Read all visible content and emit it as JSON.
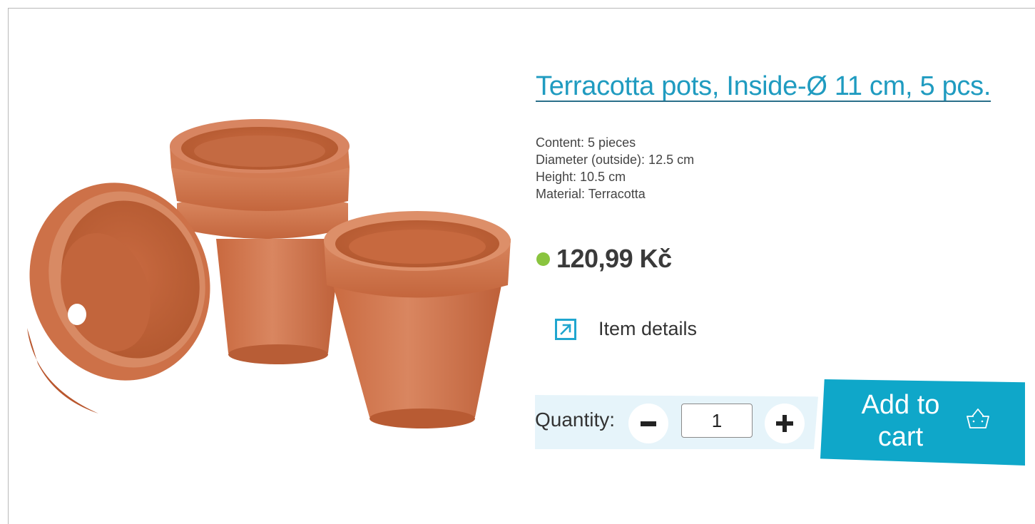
{
  "product": {
    "title": "Terracotta pots, Inside-Ø 11 cm, 5 pcs.",
    "specs": [
      "Content: 5 pieces",
      "Diameter (outside): 12.5 cm",
      "Height: 10.5 cm",
      "Material: Terracotta"
    ],
    "price": "120,99 Kč",
    "availability_color": "#8ac43f"
  },
  "details_link": {
    "label": "Item details",
    "icon": "external-link-arrow-icon"
  },
  "quantity": {
    "label": "Quantity:",
    "value": "1",
    "minus_icon": "minus-icon",
    "plus_icon": "plus-icon"
  },
  "cart": {
    "label": "Add to\ncart",
    "icon": "shopping-basket-icon"
  },
  "colors": {
    "accent": "#0fa7c9",
    "title": "#1f9bc0",
    "terracotta": "#d5794f",
    "quantity_background": "#e6f4fa"
  }
}
